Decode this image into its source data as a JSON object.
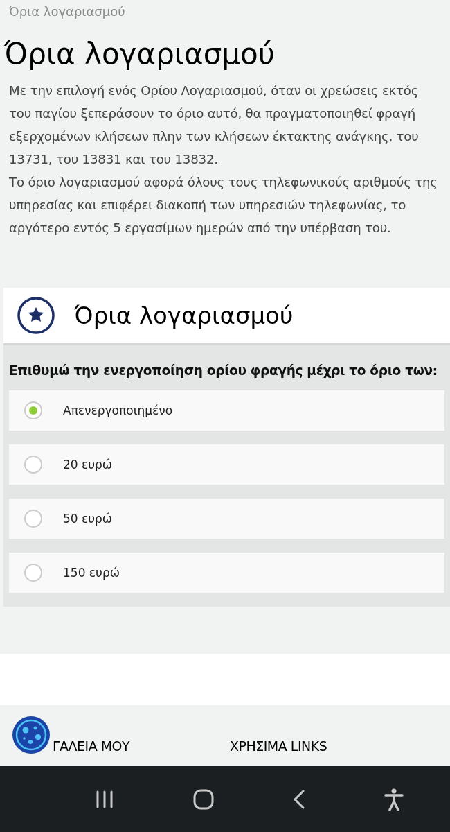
{
  "breadcrumb": "Όρια λογαριασμού",
  "title": "Όρια λογαριασμού",
  "description": [
    "Με την επιλογή ενός Ορίου Λογαριασμού, όταν οι χρεώσεις εκτός του παγίου ξεπεράσουν το όριο αυτό, θα πραγματοποιηθεί φραγή εξερχομένων κλήσεων πλην των κλήσεων έκτακτης ανάγκης, του 13731, του 13831 και του 13832.",
    "Το όριο λογαριασμού αφορά όλους τους τηλεφωνικούς αριθμούς της υπηρεσίας και επιφέρει διακοπή των υπηρεσιών τηλεφωνίας, το αργότερο εντός 5 εργασίμων ημερών από την υπέρβαση του."
  ],
  "card": {
    "title": "Όρια λογαριασμού",
    "question": "Επιθυμώ την ενεργοποίηση ορίου φραγής μέχρι το όριο των:",
    "options": [
      {
        "label": "Απενεργοποιημένο",
        "selected": true
      },
      {
        "label": "20 ευρώ",
        "selected": false
      },
      {
        "label": "50 ευρώ",
        "selected": false
      },
      {
        "label": "150 ευρώ",
        "selected": false
      }
    ]
  },
  "footer": {
    "links": [
      "ΓΑΛΕΙΑ ΜΟΥ",
      "ΧΡΗΣΙΜΑ LINKS"
    ]
  }
}
